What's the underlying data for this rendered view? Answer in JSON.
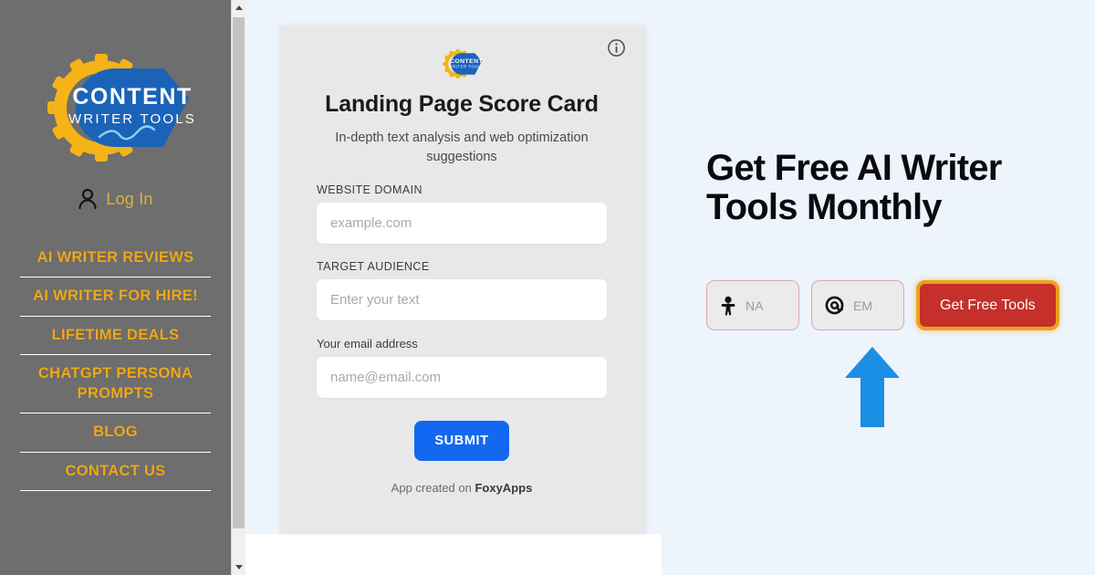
{
  "sidebar": {
    "logo": {
      "icon": "content-writer-tools-logo",
      "line1": "CONTENT",
      "line2": "WRITER TOOLS"
    },
    "login": {
      "icon": "account-person-icon",
      "label": "Log In"
    },
    "nav_items": [
      {
        "label": "AI WRITER REVIEWS"
      },
      {
        "label": "AI WRITER FOR HIRE!"
      },
      {
        "label": "LIFETIME DEALS"
      },
      {
        "label": "CHATGPT PERSONA PROMPTS"
      },
      {
        "label": "BLOG"
      },
      {
        "label": "CONTACT US"
      }
    ],
    "background_color": "#6e6e6e",
    "link_color": "#f0a818"
  },
  "scrollbar": {
    "up_icon": "chevron-up-icon",
    "down_icon": "chevron-down-icon"
  },
  "card": {
    "info_icon": "info-circle-icon",
    "logo_icon": "content-writer-tools-logo",
    "title": "Landing Page Score Card",
    "subtitle": "In-depth text analysis and web optimization suggestions",
    "fields": [
      {
        "label": "WEBSITE DOMAIN",
        "placeholder": "example.com",
        "value": ""
      },
      {
        "label": "TARGET AUDIENCE",
        "placeholder": "Enter your text",
        "value": ""
      },
      {
        "label": "Your email address",
        "placeholder": "name@email.com",
        "value": ""
      }
    ],
    "submit_label": "SUBMIT",
    "footer_prefix": "App created on ",
    "footer_brand": "FoxyApps",
    "background_color": "#e8e8e8",
    "submit_color": "#1268f0"
  },
  "promo": {
    "headline": "Get Free AI Writer Tools Monthly",
    "name_field": {
      "icon": "person-icon",
      "placeholder": "NA",
      "value": ""
    },
    "email_field": {
      "icon": "at-sign-icon",
      "placeholder": "EM",
      "value": ""
    },
    "cta_label": "Get Free Tools",
    "cta_color": "#c5302b",
    "cta_border_color": "#eda01c",
    "arrow_icon": "up-arrow-annotation",
    "arrow_color": "#1a8fe3",
    "background_color": "#edf4fc"
  }
}
